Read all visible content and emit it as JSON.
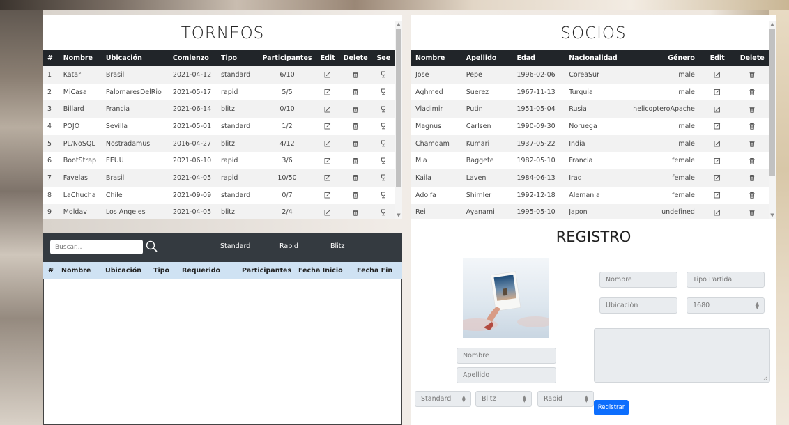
{
  "torneos": {
    "title": "TORNEOS",
    "columns": [
      "#",
      "Nombre",
      "Ubicación",
      "Comienzo",
      "Tipo",
      "Participantes",
      "Edit",
      "Delete",
      "See"
    ],
    "rows": [
      {
        "n": "1",
        "nombre": "Katar",
        "ubicacion": "Brasil",
        "comienzo": "2021-04-12",
        "tipo": "standard",
        "part": "6/10"
      },
      {
        "n": "2",
        "nombre": "MiCasa",
        "ubicacion": "PalomaresDelRio",
        "comienzo": "2021-05-17",
        "tipo": "rapid",
        "part": "5/5"
      },
      {
        "n": "3",
        "nombre": "Billard",
        "ubicacion": "Francia",
        "comienzo": "2021-06-14",
        "tipo": "blitz",
        "part": "0/10"
      },
      {
        "n": "4",
        "nombre": "POJO",
        "ubicacion": "Sevilla",
        "comienzo": "2021-05-01",
        "tipo": "standard",
        "part": "1/2"
      },
      {
        "n": "5",
        "nombre": "PL/NoSQL",
        "ubicacion": "Nostradamus",
        "comienzo": "2016-04-27",
        "tipo": "blitz",
        "part": "4/12"
      },
      {
        "n": "6",
        "nombre": "BootStrap",
        "ubicacion": "EEUU",
        "comienzo": "2021-06-10",
        "tipo": "rapid",
        "part": "3/6"
      },
      {
        "n": "7",
        "nombre": "Favelas",
        "ubicacion": "Brasil",
        "comienzo": "2021-04-05",
        "tipo": "rapid",
        "part": "10/50"
      },
      {
        "n": "8",
        "nombre": "LaChucha",
        "ubicacion": "Chile",
        "comienzo": "2021-09-09",
        "tipo": "standard",
        "part": "0/7"
      },
      {
        "n": "9",
        "nombre": "Moldav",
        "ubicacion": "Los Ángeles",
        "comienzo": "2021-04-05",
        "tipo": "blitz",
        "part": "2/4"
      }
    ]
  },
  "socios": {
    "title": "SOCIOS",
    "columns": [
      "Nombre",
      "Apellido",
      "Edad",
      "Nacionalidad",
      "Género",
      "Edit",
      "Delete"
    ],
    "rows": [
      {
        "nombre": "Jose",
        "apellido": "Pepe",
        "edad": "1996-02-06",
        "nac": "CoreaSur",
        "genero": "male"
      },
      {
        "nombre": "Aghmed",
        "apellido": "Suerez",
        "edad": "1967-11-13",
        "nac": "Turquia",
        "genero": "male"
      },
      {
        "nombre": "Vladimir",
        "apellido": "Putin",
        "edad": "1951-05-04",
        "nac": "Rusia",
        "genero": "helicopteroApache"
      },
      {
        "nombre": "Magnus",
        "apellido": "Carlsen",
        "edad": "1990-09-30",
        "nac": "Noruega",
        "genero": "male"
      },
      {
        "nombre": "Chamdam",
        "apellido": "Kumari",
        "edad": "1937-05-22",
        "nac": "India",
        "genero": "male"
      },
      {
        "nombre": "Mia",
        "apellido": "Baggete",
        "edad": "1982-05-10",
        "nac": "Francia",
        "genero": "female"
      },
      {
        "nombre": "Kaila",
        "apellido": "Laven",
        "edad": "1984-06-13",
        "nac": "Iraq",
        "genero": "female"
      },
      {
        "nombre": "Adolfa",
        "apellido": "Shimler",
        "edad": "1992-12-18",
        "nac": "Alemania",
        "genero": "female"
      },
      {
        "nombre": "Rei",
        "apellido": "Ayanami",
        "edad": "1995-05-10",
        "nac": "Japon",
        "genero": "undefined"
      }
    ]
  },
  "search": {
    "placeholder": "Buscar...",
    "filters": [
      "Standard",
      "Rapid",
      "Blitz"
    ],
    "columns": [
      "#",
      "Nombre",
      "Ubicación",
      "Tipo",
      "Requerido",
      "Participantes",
      "Fecha Inicio",
      "Fecha Fin"
    ]
  },
  "registro": {
    "title": "REGISTRO",
    "nombre_torneo_placeholder": "Nombre",
    "tipo_partida_placeholder": "Tipo Partida",
    "ubicacion_placeholder": "Ubicación",
    "elo_value": "1680",
    "nombre_placeholder": "Nombre",
    "apellido_placeholder": "Apellido",
    "selects": [
      "Standard",
      "Blitz",
      "Rapid"
    ],
    "button": "Registrar"
  },
  "colors": {
    "header_dark": "#212529",
    "search_bar": "#343a40",
    "results_head": "#cfe2f3",
    "primary": "#0d6efd"
  }
}
